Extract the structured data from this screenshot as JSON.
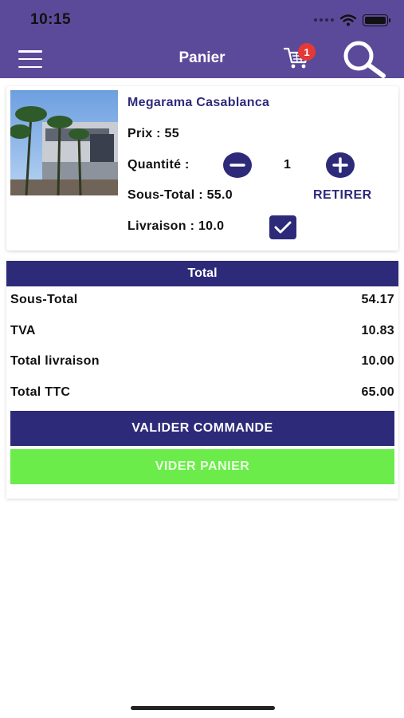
{
  "status_bar": {
    "time": "10:15"
  },
  "header": {
    "title": "Panier",
    "cart_count": "1"
  },
  "product": {
    "name": "Megarama Casablanca",
    "price_text": "Prix : 55",
    "quantity_label": "Quantité :",
    "quantity": "1",
    "subtotal_text": "Sous-Total : 55.0",
    "remove_label": "RETIRER",
    "delivery_text": "Livraison : 10.0",
    "delivery_checked": true
  },
  "totals": {
    "header": "Total",
    "rows": [
      {
        "label": "Sous-Total",
        "value": "54.17"
      },
      {
        "label": "TVA",
        "value": "10.83"
      },
      {
        "label": "Total livraison",
        "value": "10.00"
      },
      {
        "label": "Total TTC",
        "value": "65.00"
      }
    ]
  },
  "actions": {
    "validate_label": "VALIDER COMMANDE",
    "clear_label": "VIDER PANIER"
  },
  "colors": {
    "header_bg": "#5b4a9a",
    "primary": "#2e2a7a",
    "clear_button": "#6bec4b",
    "badge": "#e53935"
  },
  "icons": [
    "menu-icon",
    "cart-icon",
    "search-icon",
    "minus-icon",
    "plus-icon",
    "check-icon",
    "wifi-icon",
    "battery-icon"
  ]
}
